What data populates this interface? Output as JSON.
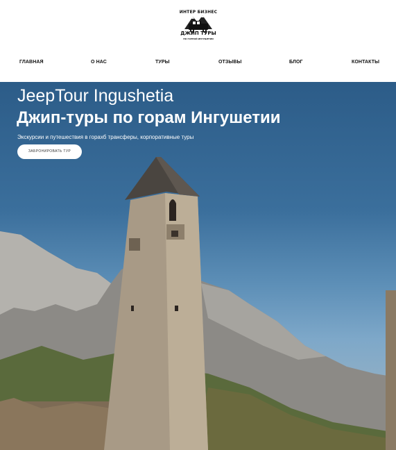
{
  "header": {
    "logo": {
      "icon": "jeep-logo-icon",
      "text_top": "ИНТЕР БИЗНЕС",
      "text_mid": "ДЖИП ТУРЫ",
      "text_bottom": "ПО ГОРНОЙ ИНГУШЕТИИ"
    },
    "nav": [
      {
        "label": "ГЛАВНАЯ"
      },
      {
        "label": "О НАС"
      },
      {
        "label": "ТУРЫ"
      },
      {
        "label": "ОТЗЫВЫ"
      },
      {
        "label": "БЛОГ"
      },
      {
        "label": "КОНТАКТЫ"
      }
    ]
  },
  "hero": {
    "title": "JeepTour Ingushetia",
    "subtitle": "Джип-туры по горам Ингушетии",
    "description": "Экскурсии и путешествия в горахб трансферы, корпоративные туры",
    "button_label": "ЗАБРОНИРОВАТЬ ТУР"
  }
}
